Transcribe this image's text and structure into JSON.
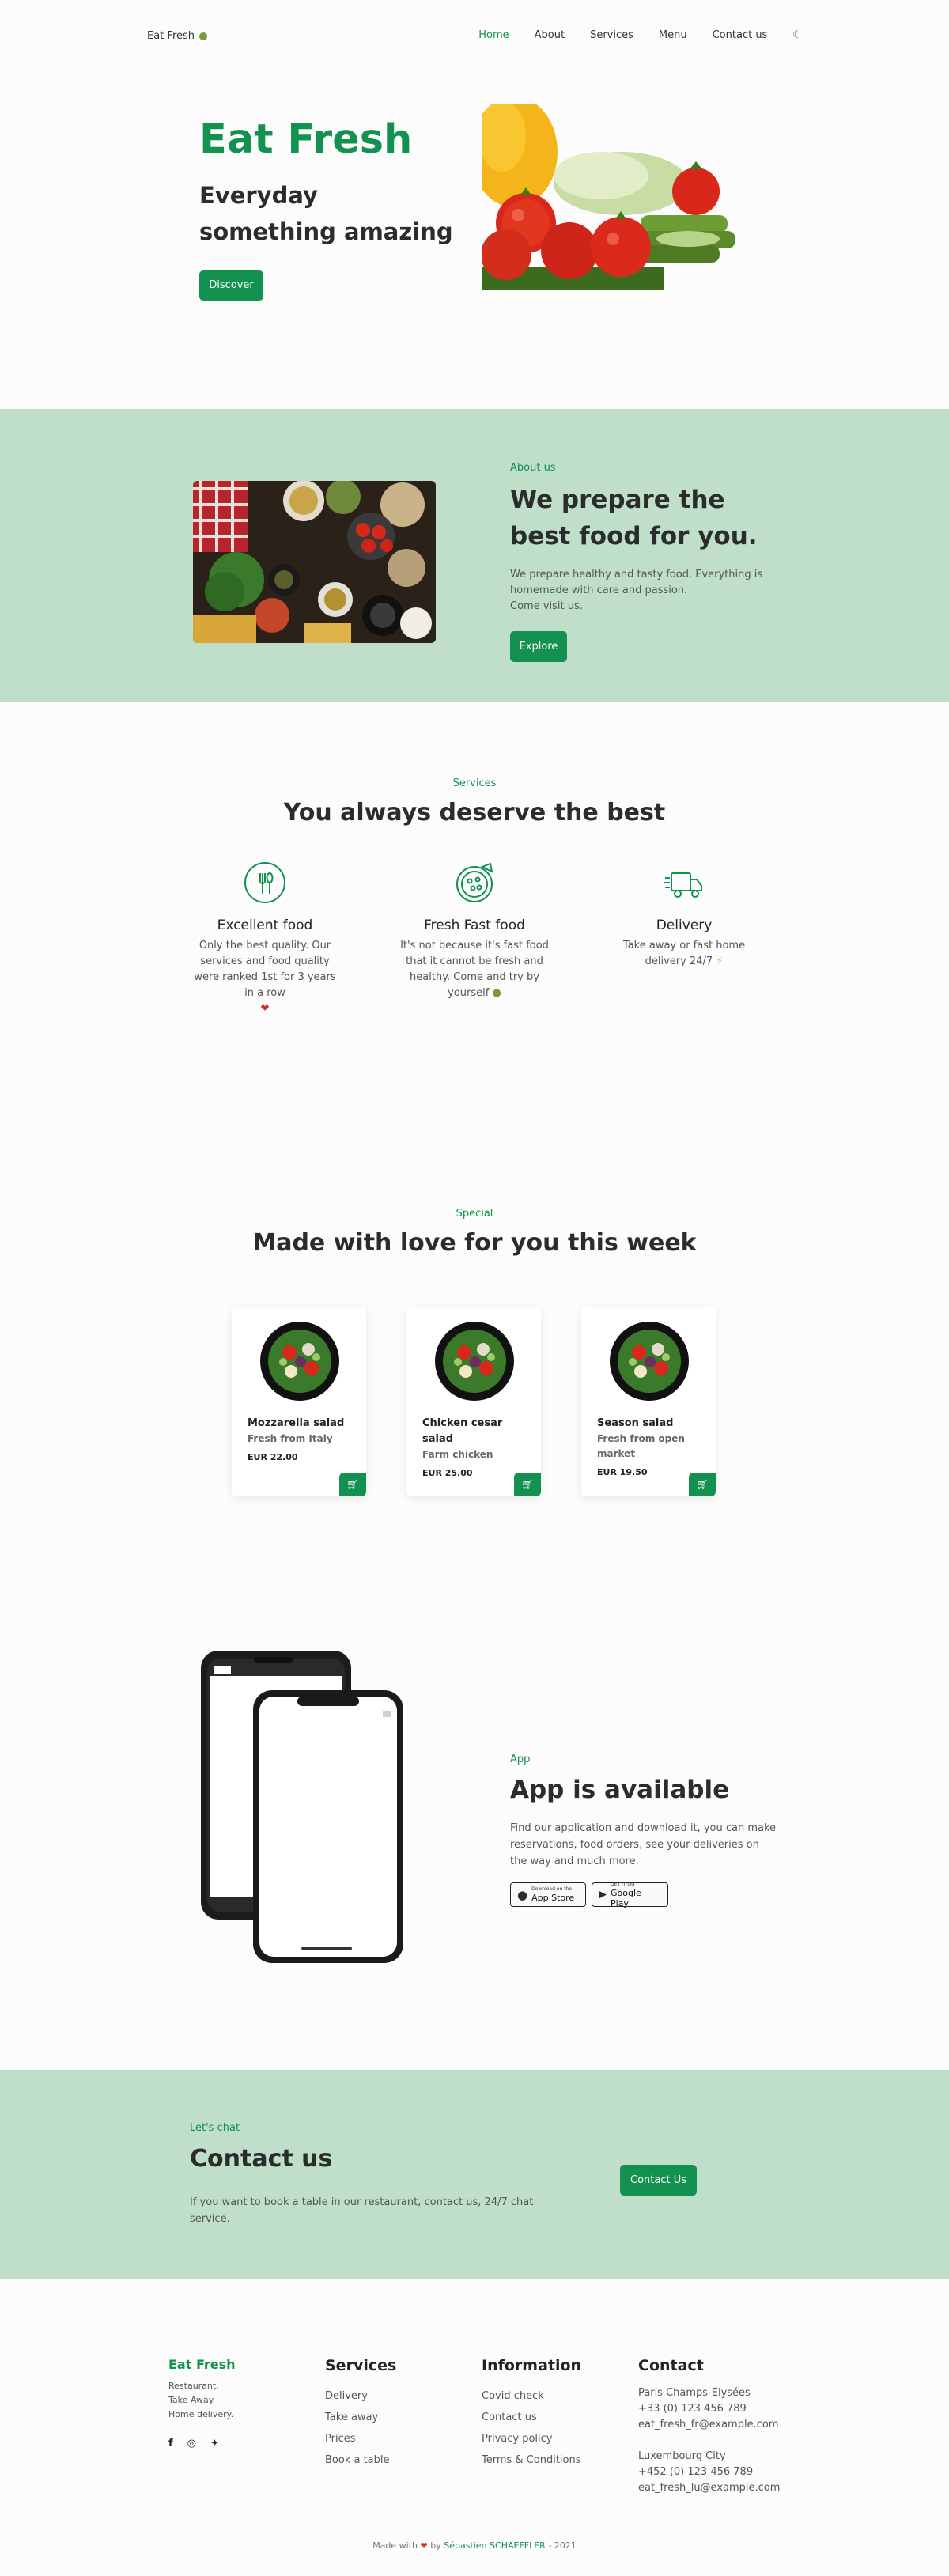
{
  "header": {
    "logo": "Eat Fresh",
    "nav": [
      "Home",
      "About",
      "Services",
      "Menu",
      "Contact us"
    ]
  },
  "hero": {
    "title": "Eat Fresh",
    "subtitle": "Everyday something amazing",
    "button": "Discover"
  },
  "about": {
    "tag": "About us",
    "title": "We prepare the best food for you.",
    "text_lines": [
      "We prepare healthy and tasty food. Everything is",
      "homemade with care and passion.",
      "Come visit us."
    ],
    "button": "Explore"
  },
  "services": {
    "tag": "Services",
    "title": "You always deserve the best",
    "items": [
      {
        "name": "Excellent food",
        "text": "Only the best quality. Our services and food quality were ranked 1st for 3 years in a row"
      },
      {
        "name": "Fresh Fast food",
        "text": "It's not because it's fast food that it cannot be fresh and healthy. Come and try by yourself"
      },
      {
        "name": "Delivery",
        "text": "Take away or fast home delivery 24/7"
      }
    ]
  },
  "special": {
    "tag": "Special",
    "title": "Made with love for you this week",
    "cards": [
      {
        "name": "Mozzarella salad",
        "desc": "Fresh from Italy",
        "price": "EUR 22.00"
      },
      {
        "name": "Chicken cesar salad",
        "desc": "Farm chicken",
        "price": "EUR 25.00"
      },
      {
        "name": "Season salad",
        "desc": "Fresh from open market",
        "price": "EUR 19.50"
      }
    ]
  },
  "app": {
    "tag": "App",
    "title": "App is available",
    "text": "Find our application and download it, you can make reservations, food orders, see your deliveries on the way and much more.",
    "appstore_small": "Download on the",
    "appstore_big": "App Store",
    "gplay_small": "GET IT ON",
    "gplay_big": "Google Play"
  },
  "contact": {
    "tag": "Let's chat",
    "title": "Contact us",
    "text": "If you want to book a table in our restaurant, contact us, 24/7 chat service.",
    "button": "Contact Us"
  },
  "footer": {
    "brand": "Eat Fresh",
    "brand_lines": [
      "Restaurant.",
      "Take Away.",
      "Home delivery."
    ],
    "services_title": "Services",
    "services_links": [
      "Delivery",
      "Take away",
      "Prices",
      "Book a table"
    ],
    "info_title": "Information",
    "info_links": [
      "Covid check",
      "Contact us",
      "Privacy policy",
      "Terms & Conditions"
    ],
    "contact_title": "Contact",
    "address1": [
      "Paris Champs-Elysées",
      "+33 (0) 123 456 789",
      "eat_fresh_fr@example.com"
    ],
    "address2": [
      "Luxembourg City",
      "+452 (0) 123 456 789",
      "eat_fresh_lu@example.com"
    ],
    "credit_prefix": "Made with",
    "credit_by": "by",
    "credit_author": "Sébastien SCHAEFFLER",
    "credit_year": "- 2021"
  },
  "colors": {
    "accent": "#129150",
    "section_bg": "#bfdfca",
    "page_bg": "#fbfcfb"
  }
}
